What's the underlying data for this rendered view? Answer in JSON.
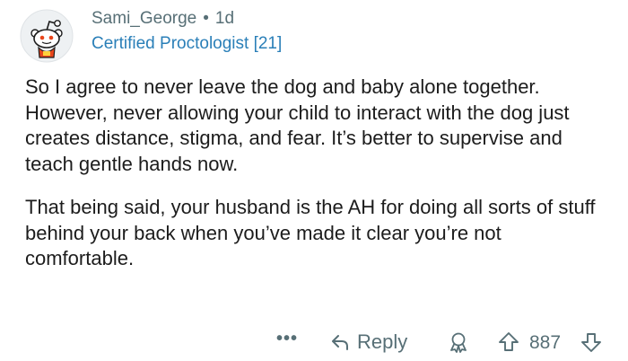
{
  "comment": {
    "author": "Sami_George",
    "separator": "•",
    "age": "1d",
    "flair": "Certified Proctologist [21]",
    "paragraphs": [
      "So I agree to never leave the dog and baby alone together. However, never allowing your child to interact with the dog just creates distance, stigma, and fear. It’s better to supervise and teach gentle hands now.",
      "That being said, your husband is the AH for doing all sorts of stuff behind your back when you’ve made it clear you’re not comfortable."
    ]
  },
  "actions": {
    "more": "•••",
    "reply_label": "Reply",
    "score": "887"
  },
  "icons": {
    "avatar": "snoo-avatar-icon",
    "reply": "reply-arrow-icon",
    "award": "award-icon",
    "upvote": "upvote-arrow-icon",
    "downvote": "downvote-arrow-icon"
  },
  "colors": {
    "meta": "#576f76",
    "flair": "#2a7fb8",
    "text": "#1c1c1c",
    "background": "#ffffff"
  }
}
